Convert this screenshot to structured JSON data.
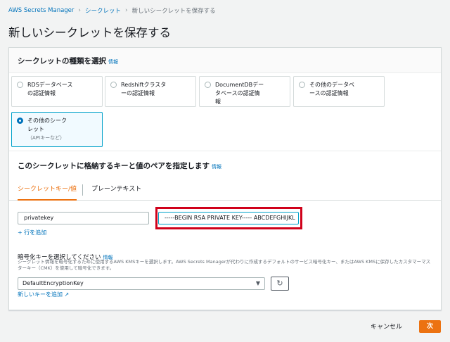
{
  "breadcrumb": {
    "items": [
      "AWS Secrets Manager",
      "シークレット",
      "新しいシークレットを保存する"
    ]
  },
  "page": {
    "title": "新しいシークレットを保存する"
  },
  "secret_type": {
    "title": "シークレットの種類を選択",
    "info": "情報",
    "options": [
      {
        "label": "RDSデータベースの認証情報",
        "line1": "RDSデータベース",
        "line2": "の認証情報",
        "selected": false
      },
      {
        "label": "Redshiftクラスターの認証情報",
        "line1": "Redshiftクラスタ",
        "line2": "ーの認証情報",
        "selected": false
      },
      {
        "label": "DocumentDBデータベースの認証情報",
        "line1": "DocumentDBデー",
        "line2": "タベースの認証情",
        "line3": "報",
        "selected": false
      },
      {
        "label": "その他のデータベースの認証情報",
        "line1": "その他のデータベ",
        "line2": "ースの認証情報",
        "selected": false
      },
      {
        "label": "その他のシークレット",
        "line1": "その他のシーク",
        "line2": "レット",
        "sub": "（APIキーなど）",
        "selected": true
      }
    ]
  },
  "key_value": {
    "title": "このシークレットに格納するキーと値のペアを指定します",
    "info": "情報",
    "tabs": [
      "シークレットキー/値",
      "プレーンテキスト"
    ],
    "active_tab": "シークレットキー/値",
    "key_value": "privatekey",
    "secret_value": "-----BEGIN RSA PRIVATE KEY----- ABCDEFGHIJKL",
    "add_row": "+ 行を追加"
  },
  "encryption": {
    "label": "暗号化キーを選択してください",
    "info": "情報",
    "description": "シークレット情報を暗号化するために使用するAWS KMSキーを選択します。AWS Secrets Managerが代わりに作成するデフォルトのサービス暗号化キー、またはAWS KMSに保存したカスタマーマスターキー（CMK）を使用して暗号化できます。",
    "selected_key": "DefaultEncryptionKey",
    "new_key_link": "新しいキーを追加"
  },
  "footer": {
    "cancel": "キャンセル",
    "next": "次"
  },
  "colors": {
    "accent": "#ec7211",
    "link": "#0073bb",
    "highlight": "#d0021b"
  }
}
